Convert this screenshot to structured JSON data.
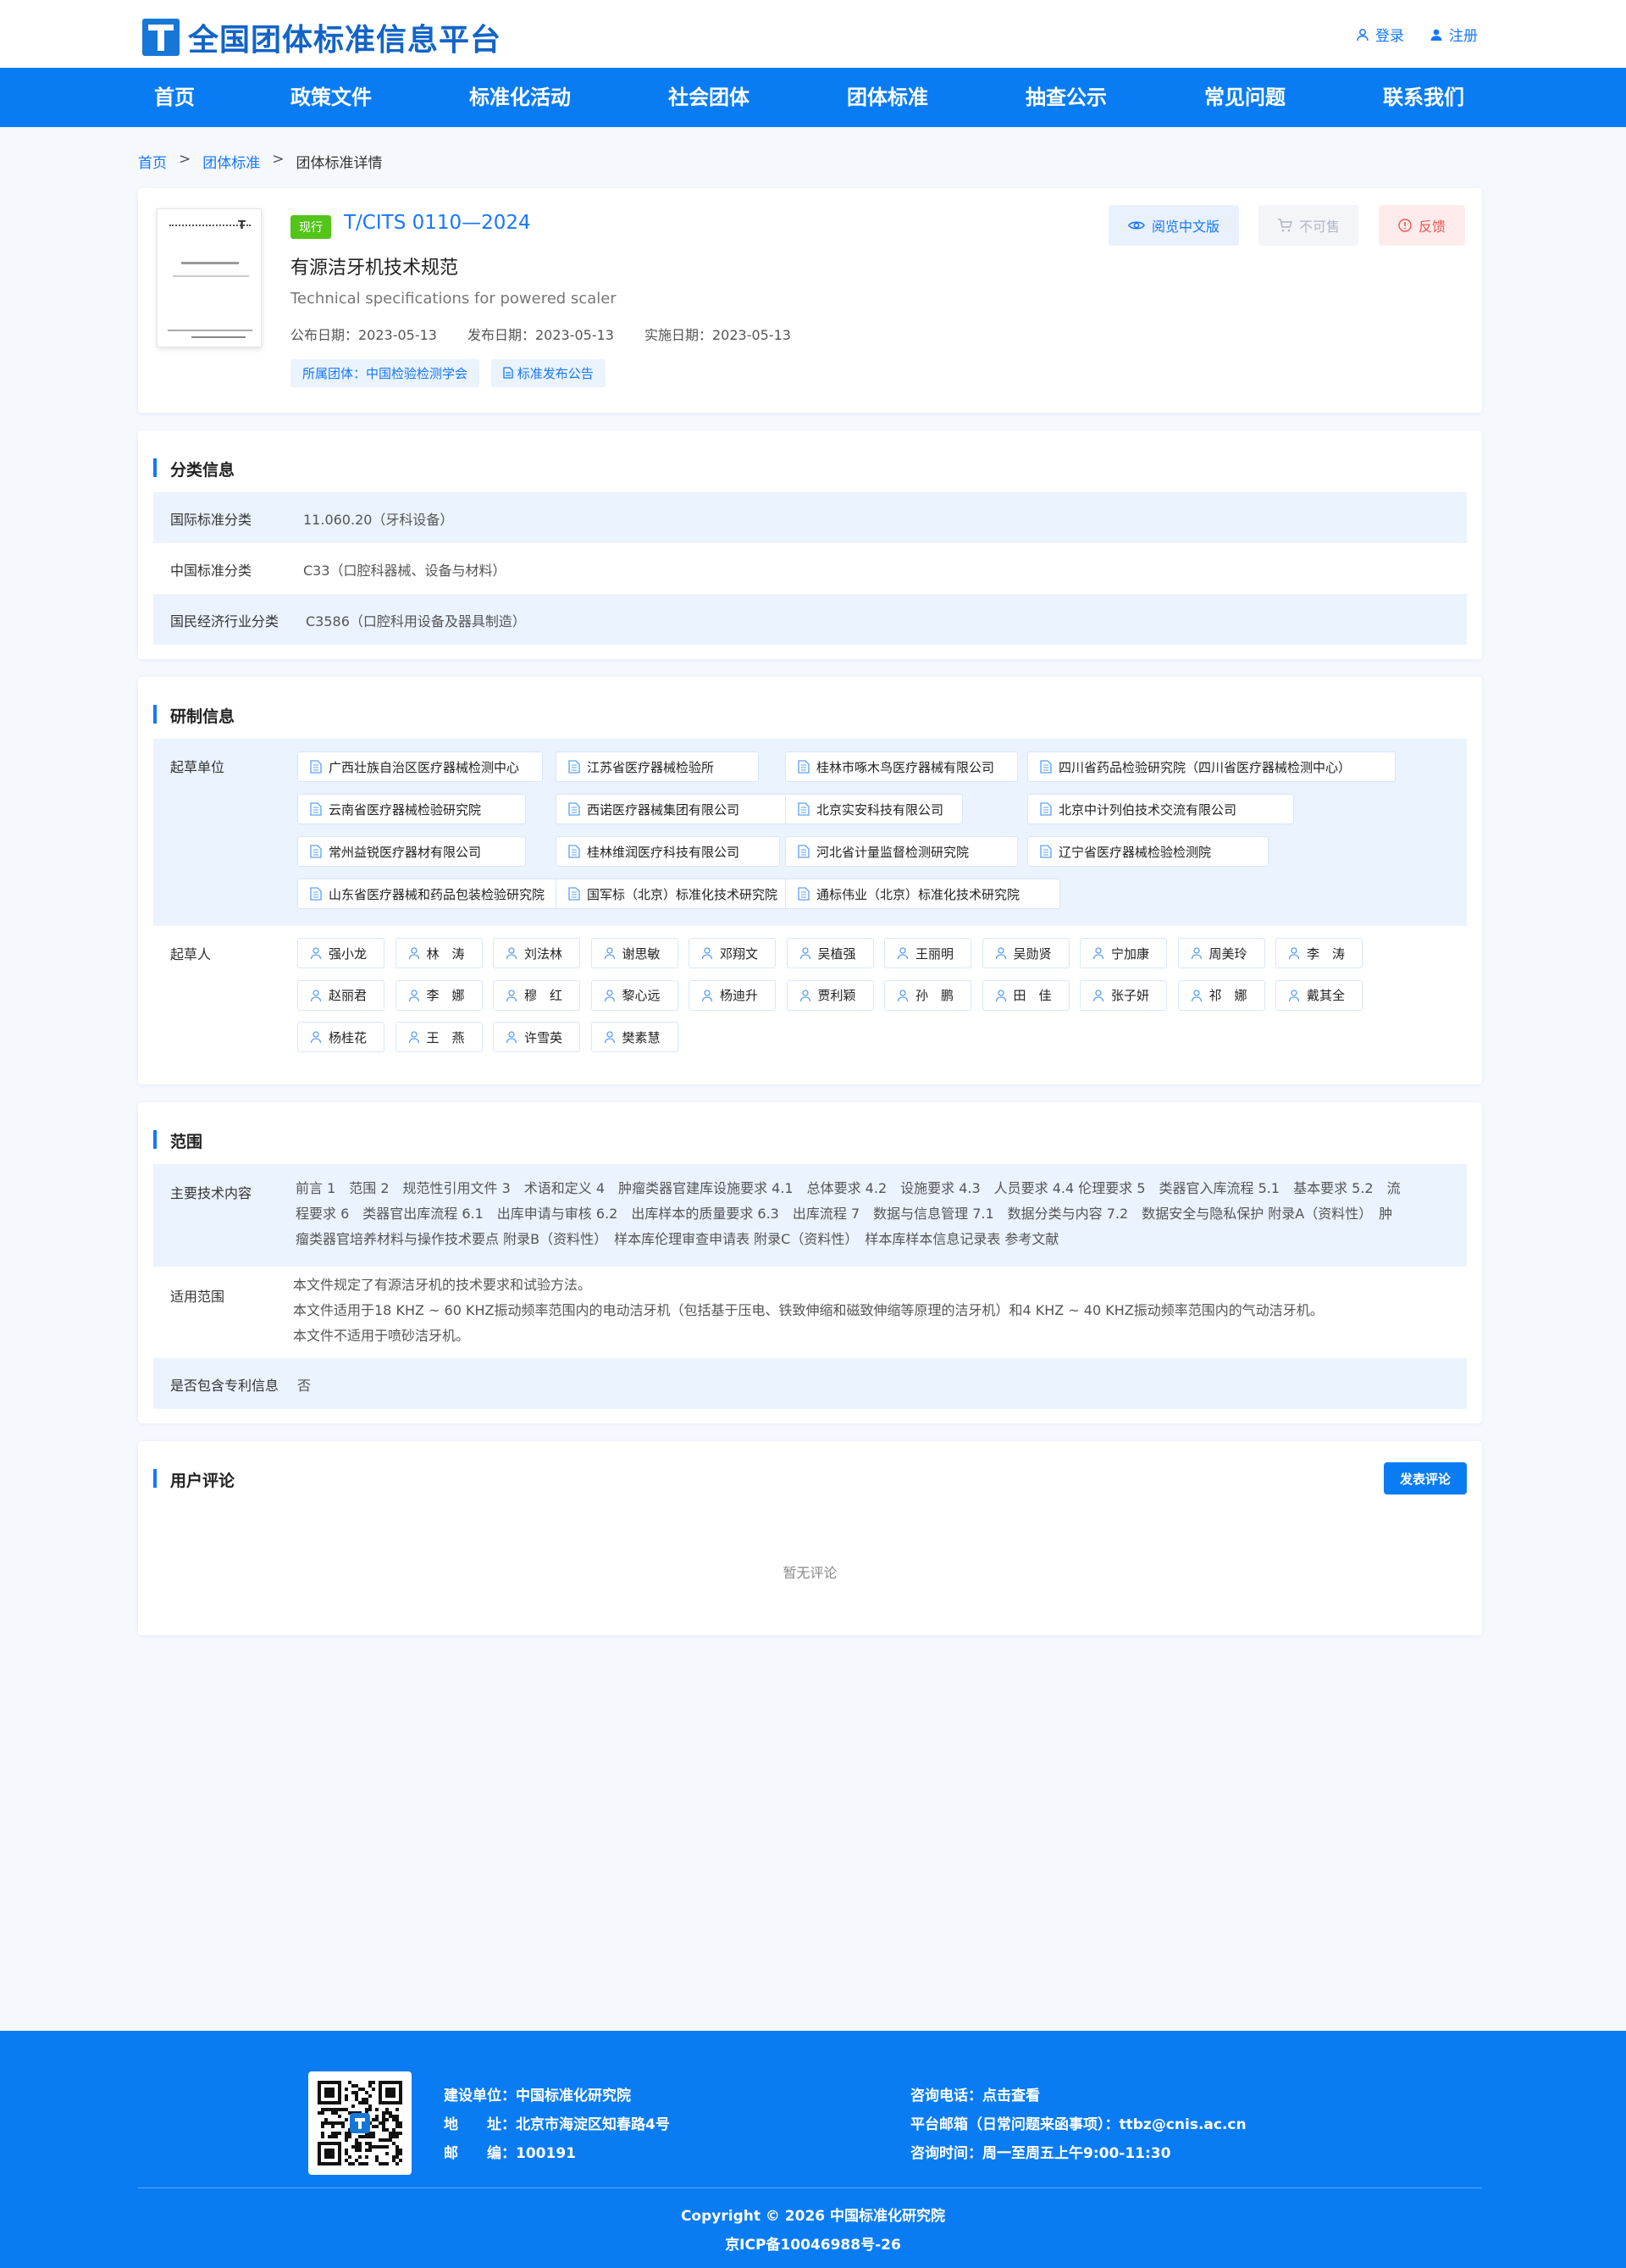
{
  "header": {
    "logo_text": "全国团体标准信息平台",
    "login_label": "登录",
    "register_label": "注册"
  },
  "nav": [
    "首页",
    "政策文件",
    "标准化活动",
    "社会团体",
    "团体标准",
    "抽查公示",
    "常见问题",
    "联系我们"
  ],
  "breadcrumb": {
    "home": "首页",
    "sep1": ">",
    "list": "团体标准",
    "sep2": ">",
    "current": "团体标准详情"
  },
  "standard": {
    "status": "现行",
    "code": "T/CITS 0110—2024",
    "title_cn": "有源洁牙机技术规范",
    "title_en": "Technical specifications for powered scaler",
    "announce_date": "公布日期：2023-05-13",
    "publish_date": "发布日期：2023-05-13",
    "implement_date": "实施日期：2023-05-13",
    "org_tag": "所属团体：中国检验检测学会",
    "notice_tag": "标准发布公告",
    "btn_preview": "阅览中文版",
    "btn_not_for_sale": "不可售",
    "btn_feedback": "反馈"
  },
  "classification": {
    "title": "分类信息",
    "rows": [
      {
        "label": "国际标准分类",
        "value": "11.060.20（牙科设备）"
      },
      {
        "label": "中国标准分类",
        "value": "C33（口腔科器械、设备与材料）"
      },
      {
        "label": "国民经济行业分类",
        "value": "C3586（口腔科用设备及器具制造）"
      }
    ]
  },
  "development": {
    "title": "研制信息",
    "units_label": "起草单位",
    "units": [
      "广西壮族自治区医疗器械检测中心",
      "江苏省医疗器械检验所",
      "桂林市啄木鸟医疗器械有限公司",
      "四川省药品检验研究院（四川省医疗器械检测中心）",
      "云南省医疗器械检验研究院",
      "西诺医疗器械集团有限公司",
      "北京实安科技有限公司",
      "北京中计列伯技术交流有限公司",
      "常州益锐医疗器材有限公司",
      "桂林维润医疗科技有限公司",
      "河北省计量监督检测研究院",
      "辽宁省医疗器械检验检测院",
      "山东省医疗器械和药品包装检验研究院",
      "国军标（北京）标准化技术研究院",
      "通标伟业（北京）标准化技术研究院"
    ],
    "people_label": "起草人",
    "people": [
      "强小龙",
      "林　涛",
      "刘法林",
      "谢思敏",
      "邓翔文",
      "吴植强",
      "王丽明",
      "吴勋贤",
      "宁加康",
      "周美玲",
      "李　涛",
      "赵丽君",
      "李　娜",
      "穆　红",
      "黎心远",
      "杨迪升",
      "贾利颖",
      "孙　鹏",
      "田　佳",
      "张子妍",
      "祁　娜",
      "戴其全",
      "杨桂花",
      "王　燕",
      "许雪英",
      "樊素慧"
    ]
  },
  "scope": {
    "title": "范围",
    "tech_label": "主要技术内容",
    "tech_lines": [
      "前言 1　范围 2　规范性引用文件 3　术语和定义 4　肿瘤类器官建库设施要求 4.1　总体要求 4.2　设施要求 4.3　人员要求 4.4 伦理要求 5　类器官入库流程 5.1　基本要求 5.2　流",
      "程要求 6　类器官出库流程 6.1　出库申请与审核 6.2　出库样本的质量要求 6.3　出库流程 7　数据与信息管理 7.1　数据分类与内容 7.2　数据安全与隐私保护 附录A（资料性）　肿",
      "瘤类器官培养材料与操作技术要点 附录B（资料性）　样本库伦理审查申请表 附录C（资料性）　样本库样本信息记录表 参考文献"
    ],
    "apply_label": "适用范围",
    "apply_lines": [
      "本文件规定了有源洁牙机的技术要求和试验方法。",
      "本文件适用于18 KHZ ~ 60 KHZ振动频率范围内的电动洁牙机（包括基于压电、铁致伸缩和磁致伸缩等原理的洁牙机）和4 KHZ ~ 40 KHZ振动频率范围内的气动洁牙机。",
      "本文件不适用于喷砂洁牙机。"
    ],
    "patent_label": "是否包含专利信息",
    "patent_value": "否"
  },
  "comments": {
    "title": "用户评论",
    "post_button": "发表评论",
    "empty_text": "暂无评论"
  },
  "footer": {
    "builder": "建设单位：中国标准化研究院",
    "address": "地　　址：北京市海淀区知春路4号",
    "postcode": "邮　　编：100191",
    "phone": "咨询电话：点击查看",
    "email": "平台邮箱（日常问题来函事项）：ttbz@cnis.ac.cn",
    "hours": "咨询时间：周一至周五上午9:00-11:30",
    "copyright": "Copyright © 2026 中国标准化研究院",
    "icp": "京ICP备10046988号-26"
  },
  "colors": {
    "primary": "#0a7cf3",
    "link": "#1677ff",
    "status_green": "#52c41a",
    "feedback_red": "#f0544f",
    "row_alt": "#eaf3fe"
  }
}
